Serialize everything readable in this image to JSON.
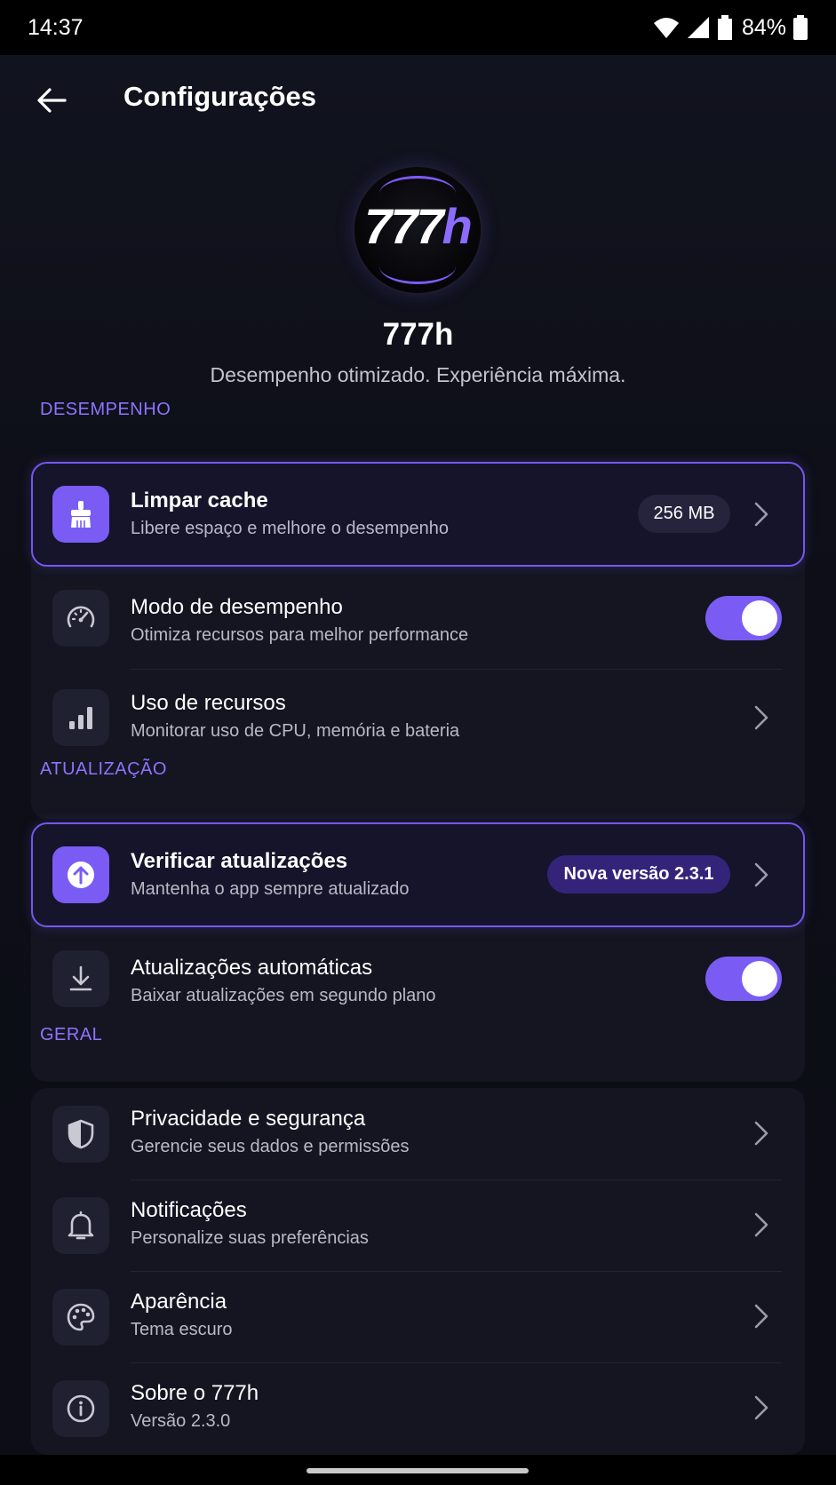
{
  "status_bar": {
    "time": "14:37",
    "battery_percent": "84%"
  },
  "header": {
    "title": "Configurações"
  },
  "hero": {
    "logo_text_main": "777",
    "logo_text_accent": "h",
    "app_name": "777h",
    "tagline": "Desempenho otimizado. Experiência máxima."
  },
  "sections": {
    "performance": {
      "label": "DESEMPENHO",
      "items": [
        {
          "title": "Limpar cache",
          "subtitle": "Libere espaço e melhore o desempenho",
          "badge": "256 MB",
          "icon": "broom-icon"
        },
        {
          "title": "Modo de desempenho",
          "subtitle": "Otimiza recursos para melhor performance",
          "toggle_on": true,
          "icon": "speedometer-icon"
        },
        {
          "title": "Uso de recursos",
          "subtitle": "Monitorar uso de CPU, memória e bateria",
          "icon": "bar-chart-icon"
        }
      ]
    },
    "updates": {
      "label": "ATUALIZAÇÃO",
      "items": [
        {
          "title": "Verificar atualizações",
          "subtitle": "Mantenha o app sempre atualizado",
          "badge": "Nova versão 2.3.1",
          "icon": "upload-arrow-icon"
        },
        {
          "title": "Atualizações automáticas",
          "subtitle": "Baixar atualizações em segundo plano",
          "toggle_on": true,
          "icon": "download-icon"
        }
      ]
    },
    "general": {
      "label": "GERAL",
      "items": [
        {
          "title": "Privacidade e segurança",
          "subtitle": "Gerencie seus dados e permissões",
          "icon": "shield-icon"
        },
        {
          "title": "Notificações",
          "subtitle": "Personalize suas preferências",
          "icon": "bell-icon"
        },
        {
          "title": "Aparência",
          "subtitle": "Tema escuro",
          "icon": "palette-icon"
        },
        {
          "title": "Sobre o 777h",
          "subtitle": "Versão 2.3.0",
          "icon": "info-icon"
        }
      ]
    }
  },
  "colors": {
    "accent": "#7a5cf5",
    "section_label": "#8f73ff",
    "background": "#0d0e16",
    "card": "#141521"
  }
}
